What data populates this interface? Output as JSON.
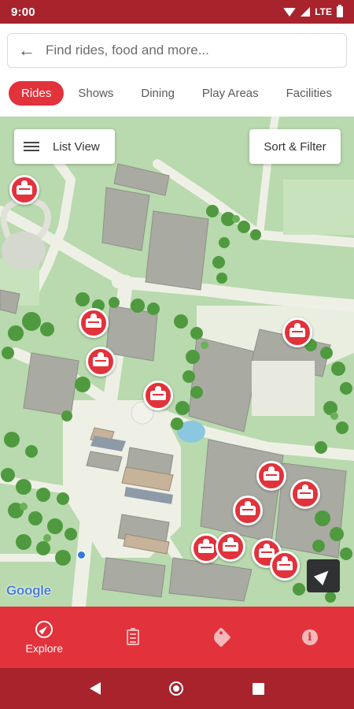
{
  "status_bar": {
    "time": "9:00",
    "network": "LTE"
  },
  "search": {
    "placeholder": "Find rides, food and more..."
  },
  "tabs": [
    {
      "label": "Rides",
      "active": true
    },
    {
      "label": "Shows",
      "active": false
    },
    {
      "label": "Dining",
      "active": false
    },
    {
      "label": "Play Areas",
      "active": false
    },
    {
      "label": "Facilities",
      "active": false
    }
  ],
  "map": {
    "list_view_label": "List View",
    "sort_filter_label": "Sort & Filter",
    "attribution": "Google",
    "pin_icon": "ride-icon"
  },
  "bottom_nav": [
    {
      "label": "Explore",
      "icon": "compass-icon",
      "active": true
    },
    {
      "label": "",
      "icon": "clipboard-icon",
      "active": false
    },
    {
      "label": "",
      "icon": "tag-icon",
      "active": false
    },
    {
      "label": "",
      "icon": "info-icon",
      "active": false
    }
  ],
  "colors": {
    "brand_red": "#e2323b",
    "dark_red": "#a8232c",
    "map_green": "#b9d9ae"
  }
}
